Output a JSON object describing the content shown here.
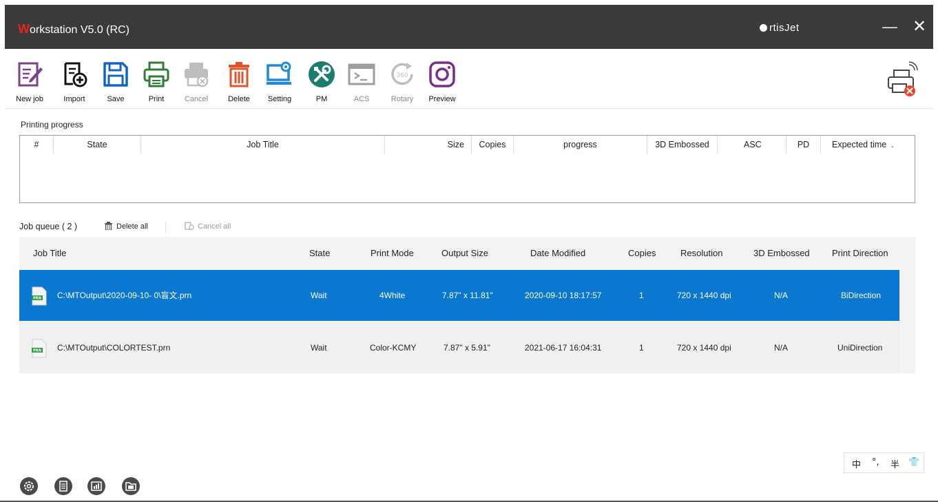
{
  "titlebar": {
    "title_first": "W",
    "title_rest": "orkstation V5.0 (RC)",
    "brand": "rtisJet",
    "minimize": "—",
    "close": "✕"
  },
  "toolbar": {
    "buttons": [
      {
        "label": "New job",
        "icon": "new-job-icon"
      },
      {
        "label": "Import",
        "icon": "import-icon"
      },
      {
        "label": "Save",
        "icon": "save-icon"
      },
      {
        "label": "Print",
        "icon": "print-icon"
      },
      {
        "label": "Cancel",
        "icon": "cancel-print-icon"
      },
      {
        "label": "Delete",
        "icon": "trash-icon"
      },
      {
        "label": "Setting",
        "icon": "setting-monitor-icon"
      },
      {
        "label": "PM",
        "icon": "tools-icon"
      },
      {
        "label": "ACS",
        "icon": "terminal-icon"
      },
      {
        "label": "Rotary",
        "icon": "rotary-360-icon"
      },
      {
        "label": "Preview",
        "icon": "preview-icon"
      }
    ]
  },
  "progress": {
    "section_label": "Printing progress",
    "columns": [
      "#",
      "State",
      "Job Title",
      "Size",
      "Copies",
      "progress",
      "3D Embossed",
      "ASC",
      "PD",
      "Expected time"
    ],
    "column_extra": "."
  },
  "queue": {
    "title": "Job queue ( 2 )",
    "delete_all": "Delete all",
    "cancel_all": "Cancel all",
    "columns": [
      "Job Title",
      "State",
      "Print Mode",
      "Output Size",
      "Date Modified",
      "Copies",
      "Resolution",
      "3D Embossed",
      "Print Direction"
    ],
    "file_badge": "PRN",
    "rows": [
      {
        "title": "C:\\MTOutput\\2020-09-10- 0\\盲文.prn",
        "state": "Wait",
        "mode": "4White",
        "size": "7.87\" x 11.81\"",
        "date": "2020-09-10 18:17:57",
        "copies": "1",
        "resolution": "720 x 1440 dpi",
        "embossed": "N/A",
        "direction": "BiDirection"
      },
      {
        "title": "C:\\MTOutput\\COLORTEST.prn",
        "state": "Wait",
        "mode": "Color-KCMY",
        "size": "7.87\" x 5.91\"",
        "date": "2021-06-17 16:04:31",
        "copies": "1",
        "resolution": "720 x 1440 dpi",
        "embossed": "N/A",
        "direction": "UniDirection"
      }
    ]
  },
  "ime": {
    "a": "中",
    "b": "°,",
    "c": "半",
    "d": "👕"
  },
  "colors": {
    "selected_row": "#0a78d1",
    "titlebar": "#3a3a3a",
    "accent_red": "#e8231a"
  }
}
